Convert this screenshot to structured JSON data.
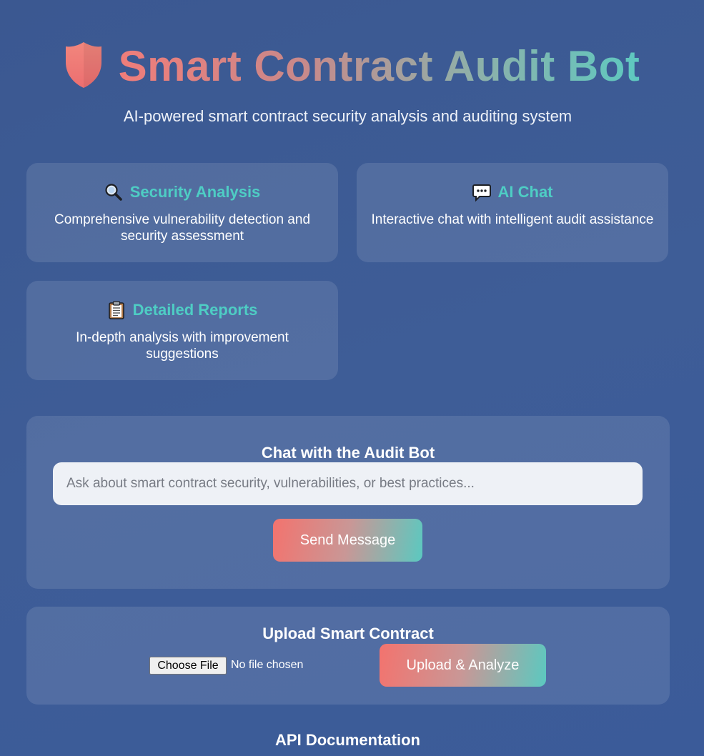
{
  "header": {
    "title": "Smart Contract Audit Bot",
    "subtitle": "AI-powered smart contract security analysis and auditing system"
  },
  "features": [
    {
      "icon": "magnifier-icon",
      "title": "Security Analysis",
      "description": "Comprehensive vulnerability detection and security assessment"
    },
    {
      "icon": "speech-bubble-icon",
      "title": "AI Chat",
      "description": "Interactive chat with intelligent audit assistance"
    },
    {
      "icon": "clipboard-icon",
      "title": "Detailed Reports",
      "description": "In-depth analysis with improvement suggestions"
    }
  ],
  "chat": {
    "title": "Chat with the Audit Bot",
    "placeholder": "Ask about smart contract security, vulnerabilities, or best practices...",
    "value": "",
    "send_label": "Send Message"
  },
  "upload": {
    "title": "Upload Smart Contract",
    "choose_label": "Choose File",
    "file_status": "No file chosen",
    "analyze_label": "Upload & Analyze"
  },
  "api": {
    "title": "API Documentation"
  },
  "colors": {
    "background": "#3c5b94",
    "accent_teal": "#4ecdc4",
    "accent_coral": "#f3736e",
    "card": "rgba(255,255,255,0.11)"
  }
}
